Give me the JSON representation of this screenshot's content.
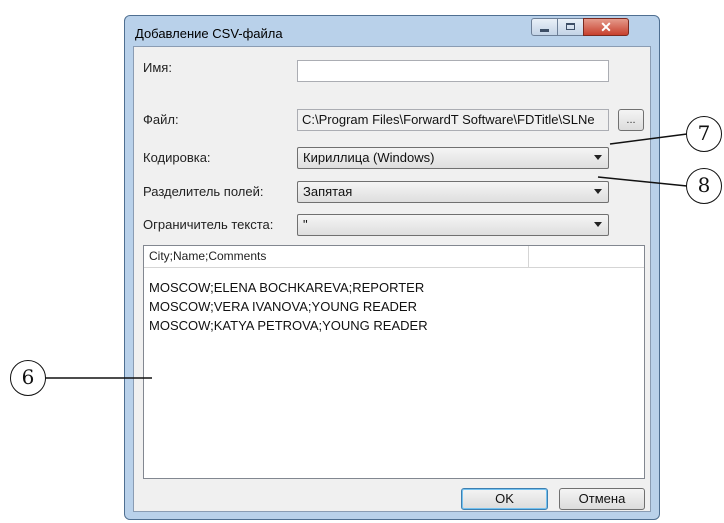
{
  "window": {
    "title": "Добавление CSV-файла"
  },
  "form": {
    "name_label": "Имя:",
    "name_value": "",
    "file_label": "Файл:",
    "file_value": "C:\\Program Files\\ForwardT Software\\FDTitle\\SLNe",
    "browse_label": "...",
    "encoding_label": "Кодировка:",
    "encoding_value": "Кириллица (Windows)",
    "separator_label": "Разделитель полей:",
    "separator_value": "Запятая",
    "delimiter_label": "Ограничитель текста:",
    "delimiter_value": "\""
  },
  "preview": {
    "header": "City;Name;Comments",
    "rows": [
      "MOSCOW;ELENA BOCHKAREVA;REPORTER",
      "MOSCOW;VERA IVANOVA;YOUNG READER",
      "MOSCOW;KATYA PETROVA;YOUNG READER"
    ]
  },
  "buttons": {
    "ok": "OK",
    "cancel": "Отмена"
  },
  "callouts": [
    "6",
    "7",
    "8"
  ]
}
